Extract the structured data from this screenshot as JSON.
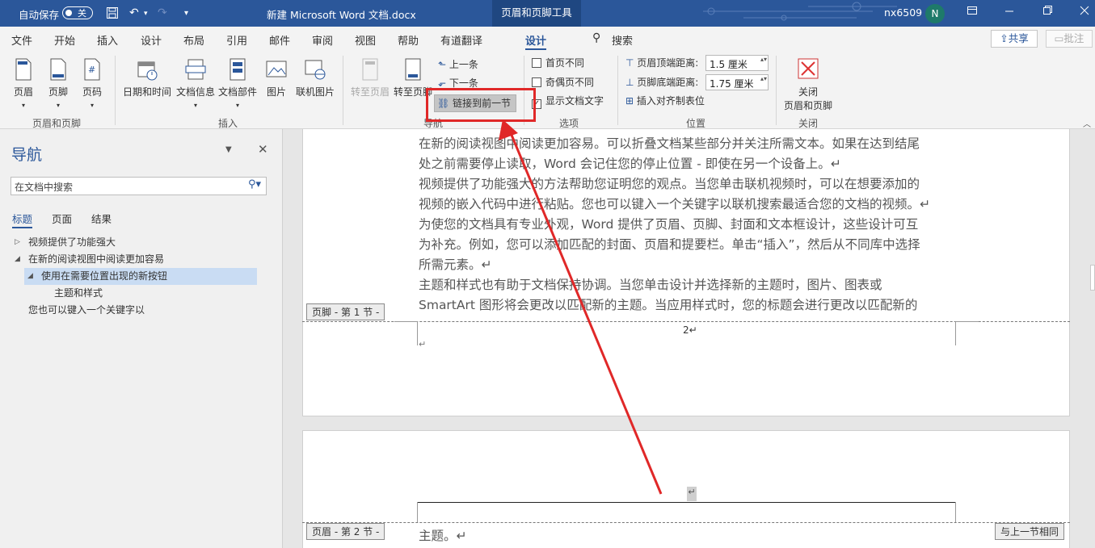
{
  "titlebar": {
    "autosave_label": "自动保存",
    "autosave_state": "关",
    "doc_title": "新建 Microsoft Word 文档.docx",
    "context_tab": "页眉和页脚工具",
    "user_name": "nx6509",
    "avatar_initial": "N"
  },
  "menu_tabs": [
    "文件",
    "开始",
    "插入",
    "设计",
    "布局",
    "引用",
    "邮件",
    "审阅",
    "视图",
    "帮助",
    "有道翻译",
    "设计"
  ],
  "search_label": "搜索",
  "share_label": "共享",
  "comment_label": "批注",
  "ribbon": {
    "header": "页眉",
    "footer": "页脚",
    "pagenum": "页码",
    "group_hf": "页眉和页脚",
    "datetime": "日期和时间",
    "docinfo": "文档信息",
    "docparts": "文档部件",
    "picture": "图片",
    "online_picture": "联机图片",
    "group_insert": "插入",
    "goto_header": "转至页眉",
    "goto_footer": "转至页脚",
    "prev": "上一条",
    "next": "下一条",
    "link_prev": "链接到前一节",
    "group_nav": "导航",
    "diff_first": "首页不同",
    "diff_odd_even": "奇偶页不同",
    "show_text": "显示文档文字",
    "group_options": "选项",
    "header_top_label": "页眉顶端距离:",
    "header_top_value": "1.5 厘米",
    "footer_bottom_label": "页脚底端距离:",
    "footer_bottom_value": "1.75 厘米",
    "insert_align_tab": "插入对齐制表位",
    "group_position": "位置",
    "close_line1": "关闭",
    "close_line2": "页眉和页脚",
    "group_close": "关闭"
  },
  "nav": {
    "title": "导航",
    "search_placeholder": "在文档中搜索",
    "tabs": [
      "标题",
      "页面",
      "结果"
    ],
    "items": [
      "视频提供了功能强大",
      "在新的阅读视图中阅读更加容易",
      "使用在需要位置出现的新按钮",
      "主题和样式",
      "您也可以键入一个关键字以"
    ]
  },
  "doc": {
    "lines": [
      "在新的阅读视图中阅读更加容易。可以折叠文档某些部分并关注所需文本。如果在达到结尾",
      "处之前需要停止读取，Word 会记住您的停止位置 - 即使在另一个设备上。↵",
      "视频提供了功能强大的方法帮助您证明您的观点。当您单击联机视频时，可以在想要添加的",
      "视频的嵌入代码中进行粘贴。您也可以键入一个关键字以联机搜索最适合您的文档的视频。↵",
      "为使您的文档具有专业外观，Word 提供了页眉、页脚、封面和文本框设计，这些设计可互",
      "为补充。例如，您可以添加匹配的封面、页眉和提要栏。单击“插入”，然后从不同库中选择",
      "所需元素。↵",
      "主题和样式也有助于文档保持协调。当您单击设计并选择新的主题时，图片、图表或",
      "SmartArt 图形将会更改以匹配新的主题。当应用样式时，您的标题会进行更改以匹配新的"
    ],
    "footer_tag": "页脚 - 第 1 节 -",
    "page_number": "2↵",
    "footer_mark": "↵",
    "header_mark": "↵",
    "header_tag": "页眉 - 第 2 节 -",
    "same_as_prev": "与上一节相同",
    "page2_line": "主题。↵"
  }
}
